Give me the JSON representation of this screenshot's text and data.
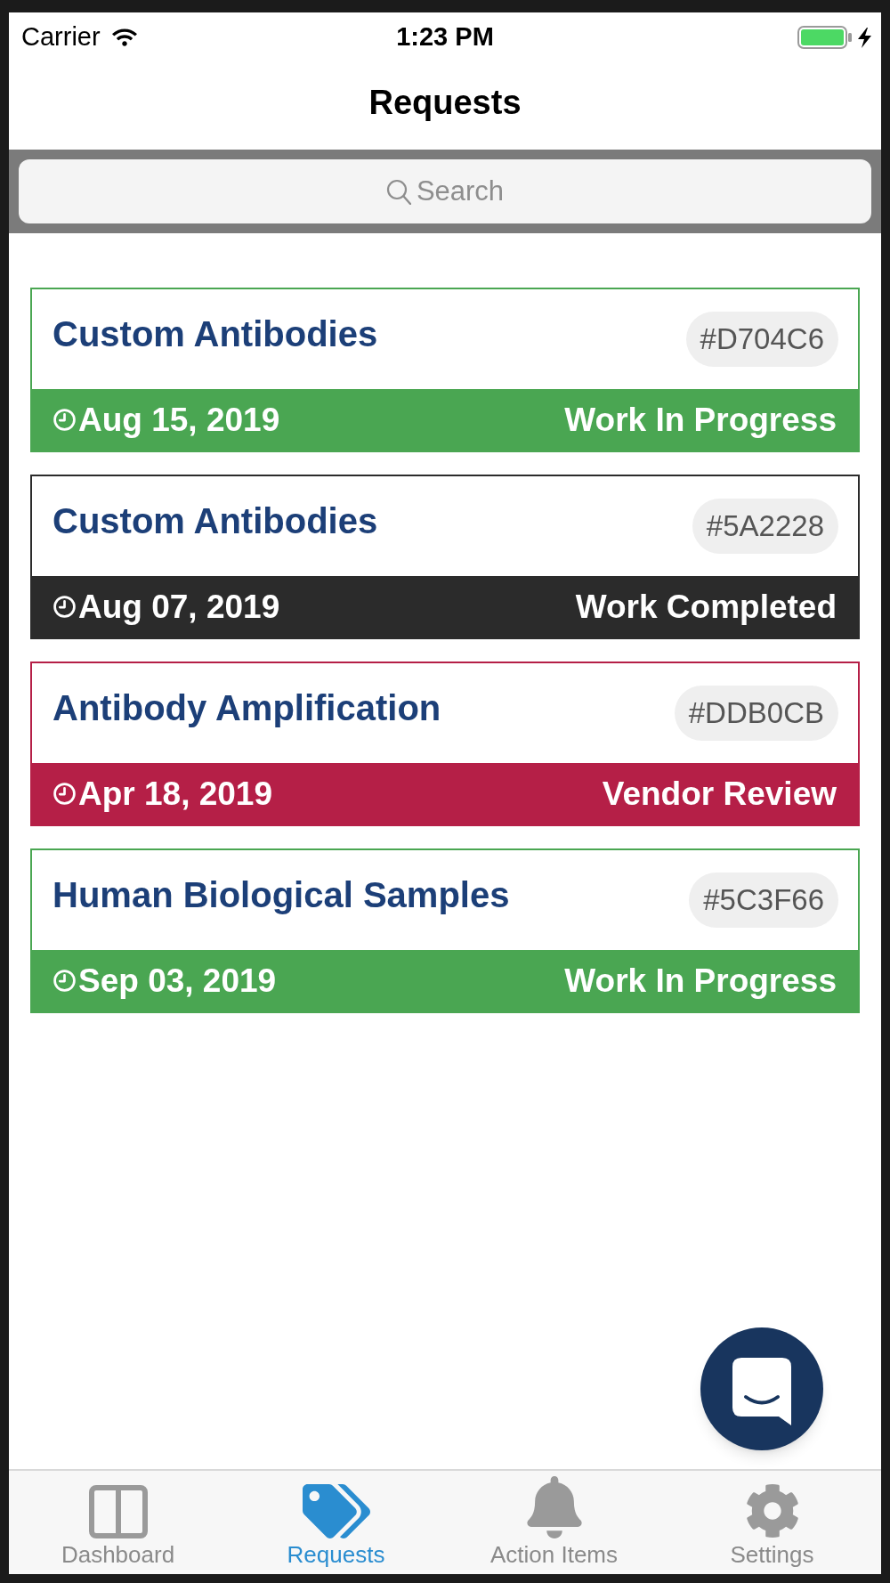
{
  "status_bar": {
    "carrier": "Carrier",
    "time": "1:23 PM"
  },
  "nav_bar": {
    "title": "Requests"
  },
  "search": {
    "placeholder": "Search"
  },
  "requests": [
    {
      "title": "Custom Antibodies",
      "id": "#D704C6",
      "date": "Aug 15, 2019",
      "status": "Work In Progress",
      "color": "#4aa652"
    },
    {
      "title": "Custom Antibodies",
      "id": "#5A2228",
      "date": "Aug 07, 2019",
      "status": "Work Completed",
      "color": "#2b2b2b"
    },
    {
      "title": "Antibody Amplification",
      "id": "#DDB0CB",
      "date": "Apr 18, 2019",
      "status": "Vendor Review",
      "color": "#b51f47"
    },
    {
      "title": "Human Biological Samples",
      "id": "#5C3F66",
      "date": "Sep 03, 2019",
      "status": "Work In Progress",
      "color": "#4aa652"
    }
  ],
  "tabs": [
    {
      "label": "Dashboard",
      "selected": false
    },
    {
      "label": "Requests",
      "selected": true
    },
    {
      "label": "Action Items",
      "selected": false
    },
    {
      "label": "Settings",
      "selected": false
    }
  ]
}
